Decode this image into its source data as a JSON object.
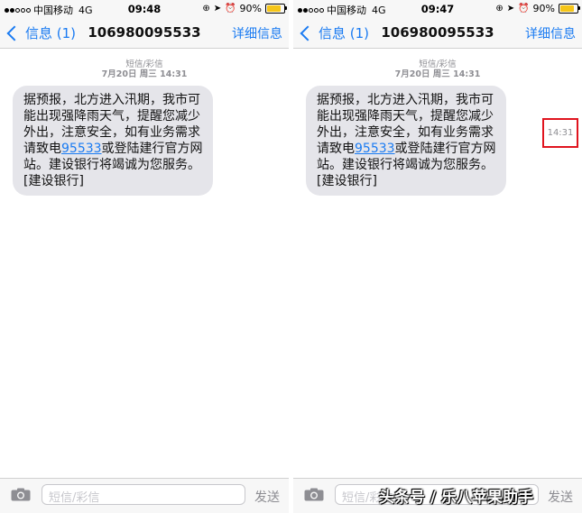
{
  "screens": [
    {
      "status": {
        "carrier": "中国移动",
        "network": "4G",
        "time": "09:48",
        "battery": "90%",
        "battery_level": 0.9
      },
      "nav": {
        "back_label": "信息 (1)",
        "title": "106980095533",
        "detail_label": "详细信息"
      },
      "meta": {
        "kind": "短信/彩信",
        "date": "7月20日 周三 14:31"
      },
      "message": {
        "lines_before": [
          "据预报，北方进入汛期，我市可",
          "能出现强降雨天气，提醒您减少",
          "外出，注意安全，如有业务需求"
        ],
        "link_prefix": "请致电",
        "phone": "95533",
        "link_suffix": "或登陆建行官方网",
        "lines_after": [
          "站。建设银行将竭诚为您服务。",
          "[建设银行]"
        ]
      },
      "input": {
        "placeholder": "短信/彩信",
        "send_label": "发送"
      }
    },
    {
      "status": {
        "carrier": "中国移动",
        "network": "4G",
        "time": "09:47",
        "battery": "90%",
        "battery_level": 0.9
      },
      "nav": {
        "back_label": "信息 (1)",
        "title": "106980095533",
        "detail_label": "详细信息"
      },
      "meta": {
        "kind": "短信/彩信",
        "date": "7月20日 周三 14:31"
      },
      "message": {
        "lines_before": [
          "据预报，北方进入汛期，我市可",
          "能出现强降雨天气，提醒您减少",
          "外出，注意安全，如有业务需求"
        ],
        "link_prefix": "请致电",
        "phone": "95533",
        "link_suffix": "或登陆建行官方网",
        "lines_after": [
          "站。建设银行将竭诚为您服务。",
          "[建设银行]"
        ]
      },
      "revealed_time": "14:31",
      "input": {
        "placeholder": "短信/彩信",
        "send_label": "发送"
      }
    }
  ],
  "watermark": "头条号 / 乐八苹果助手",
  "colors": {
    "accent": "#1a7bf2",
    "bubble": "#e5e5ea",
    "highlight": "#e0141e",
    "battery": "#f5c518"
  }
}
